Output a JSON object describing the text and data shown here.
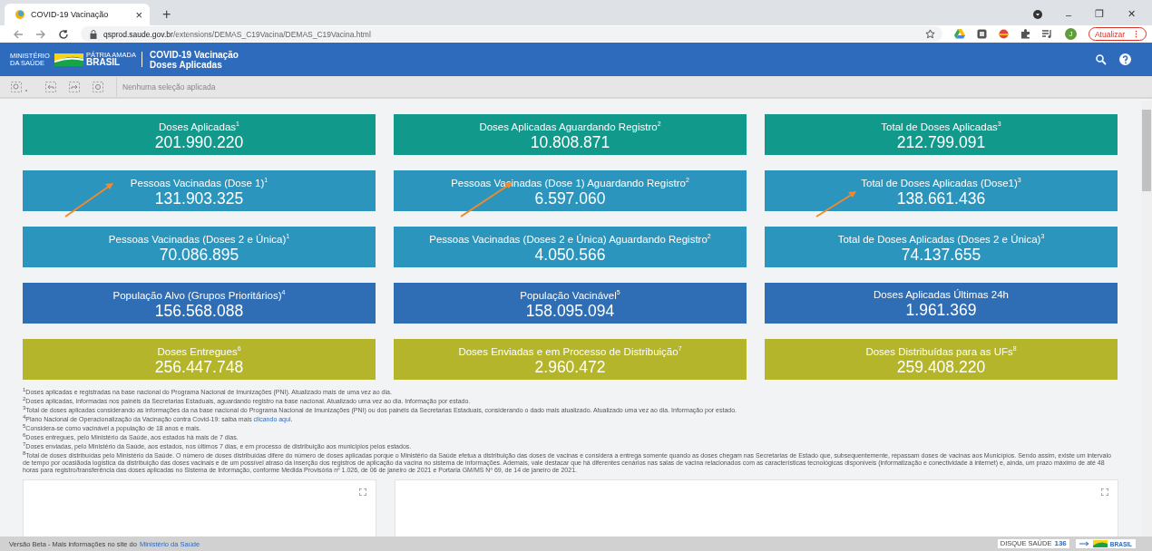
{
  "browser": {
    "tab_title": "COVID-19 Vacinação",
    "tab_close": "×",
    "new_tab": "+",
    "url_host": "qsprod.saude.gov.br",
    "url_path": "/extensions/DEMAS_C19Vacina/DEMAS_C19Vacina.html",
    "avatar": "J",
    "update_button": "Atualizar",
    "update_menu": "⋮",
    "window_controls": [
      "–",
      "❐",
      "✕"
    ]
  },
  "header": {
    "logo_ministry": "MINISTÉRIO DA SAÚDE",
    "logo_brand_small": "PÁTRIA AMADA",
    "logo_brand": "BRASIL",
    "title": "COVID-19 Vacinação",
    "subtitle": "Doses Aplicadas"
  },
  "toolbar": {
    "selection_status": "Nenhuma seleção aplicada"
  },
  "cards": [
    {
      "label": "Doses Aplicadas$^{1}$",
      "value": "201.990.220",
      "color": "#11998c"
    },
    {
      "label": "Doses Aplicadas Aguardando Registro$^{2}$",
      "value": "10.808.871",
      "color": "#11998c"
    },
    {
      "label": "Total de Doses Aplicadas$^{3}$",
      "value": "212.799.091",
      "color": "#11998c"
    },
    {
      "label": "Pessoas Vacinadas (Dose 1)$^{1}$",
      "value": "131.903.325",
      "color": "#2b95bd"
    },
    {
      "label": "Pessoas Vacinadas (Dose 1) Aguardando Registro$^{2}$",
      "value": "6.597.060",
      "color": "#2b95bd"
    },
    {
      "label": "Total de Doses Aplicadas (Dose1)$^{3}$",
      "value": "138.661.436",
      "color": "#2b95bd"
    },
    {
      "label": "Pessoas Vacinadas (Doses 2 e Única)$^{1}$",
      "value": "70.086.895",
      "color": "#2b95bd"
    },
    {
      "label": "Pessoas Vacinadas (Doses 2 e Única) Aguardando Registro$^{2}$",
      "value": "4.050.566",
      "color": "#2b95bd"
    },
    {
      "label": "Total de Doses Aplicadas (Doses 2 e Única)$^{3}$",
      "value": "74.137.655",
      "color": "#2b95bd"
    },
    {
      "label": "População Alvo (Grupos Prioritários)$^{4}$",
      "value": "156.568.088",
      "color": "#2f6db4"
    },
    {
      "label": "População Vacinável$^{5}$",
      "value": "158.095.094",
      "color": "#2f6db4"
    },
    {
      "label": "Doses Aplicadas Últimas 24h",
      "value": "1.961.369",
      "color": "#2f6db4"
    },
    {
      "label": "Doses Entregues$^{6}$",
      "value": "256.447.748",
      "color": "#b4b52b"
    },
    {
      "label": "Doses Enviadas e em Processo de Distribuição$^{7}$",
      "value": "2.960.472",
      "color": "#b4b52b"
    },
    {
      "label": "Doses Distribuídas para as UFs$^{8}$",
      "value": "259.408.220",
      "color": "#b4b52b"
    }
  ],
  "footnotes": [
    {
      "text": "$^{1}$Doses aplicadas e registradas na base nacional do Programa Nacional de Imunizações (PNI). Atualizado mais de uma vez ao dia."
    },
    {
      "text": "$^{2}$Doses aplicadas, informadas nos painéis da Secretarias Estaduais, aguardando registro na base nacional. Atualizado uma vez ao dia. Informação por estado."
    },
    {
      "text": "$^{3}$Total de doses aplicadas considerando as informações da na base nacional do Programa Nacional de Imunizações (PNI) ou dos painéis da Secretarias Estaduais, considerando o dado mais atualizado. Atualizado uma vez ao dia. Informação por estado."
    },
    {
      "text": "$^{4}$Plano Nacional de Operacionalização da Vacinação contra Covid-19: saiba mais ",
      "link": "clicando aqui",
      "after": "."
    },
    {
      "text": "$^{5}$Considera-se como vacinável a população de 18 anos e mais."
    },
    {
      "text": "$^{6}$Doses entregues, pelo Ministério da Saúde, aos estados há mais de 7 dias."
    },
    {
      "text": "$^{7}$Doses enviadas, pelo Ministério da Saúde, aos estados, nos últimos 7 dias, e em processo de distribuição aos municípios pelos estados."
    },
    {
      "text": "$^{8}$Total de doses distribuídas pelo Ministério da Saúde. O número de doses distribuídas difere do número de doses aplicadas porque o Ministério da Saúde efetua a distribuição das doses de vacinas e considera a entrega somente quando as doses chegam nas Secretarias de Estado que, subsequentemente, repassam doses de vacinas aos Municípios. Sendo assim, existe um intervalo de tempo por ocasiãoda logística da distribuição das doses vacinais e de um possível atraso da inserção dos registros de aplicação da vacina no sistema de informações. Ademais, vale destacar que há diferentes cenários nas salas de vacina relacionados com as características tecnológicas disponíveis (informatização e conectividade à internet) e, ainda, um prazo máximo de até 48 horas para registro/transferência das doses aplicadas no Sistema de Informação, conforme Medida Provisória nº 1.026, de 06 de janeiro de 2021 e Portaria GM/MS Nº 69, de 14 de janeiro de 2021."
    }
  ],
  "status_bar": {
    "text": "Versão Beta - Mais informações no site do ",
    "link": "Ministério da Saúde",
    "badge_small": "DISQUE SAÚDE",
    "badge_number": "136",
    "logo_brand": "BRASIL"
  }
}
